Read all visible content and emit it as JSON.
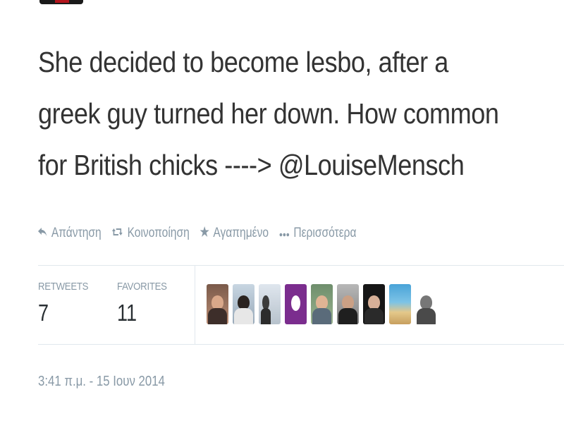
{
  "tweet": {
    "text": "She decided to become lesbo, after a\ngreek guy turned her down. How common\nfor British chicks ----> @LouiseMensch"
  },
  "actions": [
    {
      "label": "Απάντηση",
      "icon": "reply-icon"
    },
    {
      "label": "Κοινοποίηση",
      "icon": "retweet-icon"
    },
    {
      "label": "Αγαπημένο",
      "icon": "star-icon"
    },
    {
      "label": "Περισσότερα",
      "icon": "more-icon"
    }
  ],
  "stats": {
    "retweets_label": "RETWEETS",
    "retweets_count": "7",
    "favorites_label": "FAVORITES",
    "favorites_count": "11"
  },
  "timestamp": "3:41 π.μ. - 15 Ιουν 2014",
  "colors": {
    "text": "#333333",
    "muted": "#8899a6",
    "divider": "#e1e8ed",
    "purple_avatar": "#7b2d8e"
  }
}
